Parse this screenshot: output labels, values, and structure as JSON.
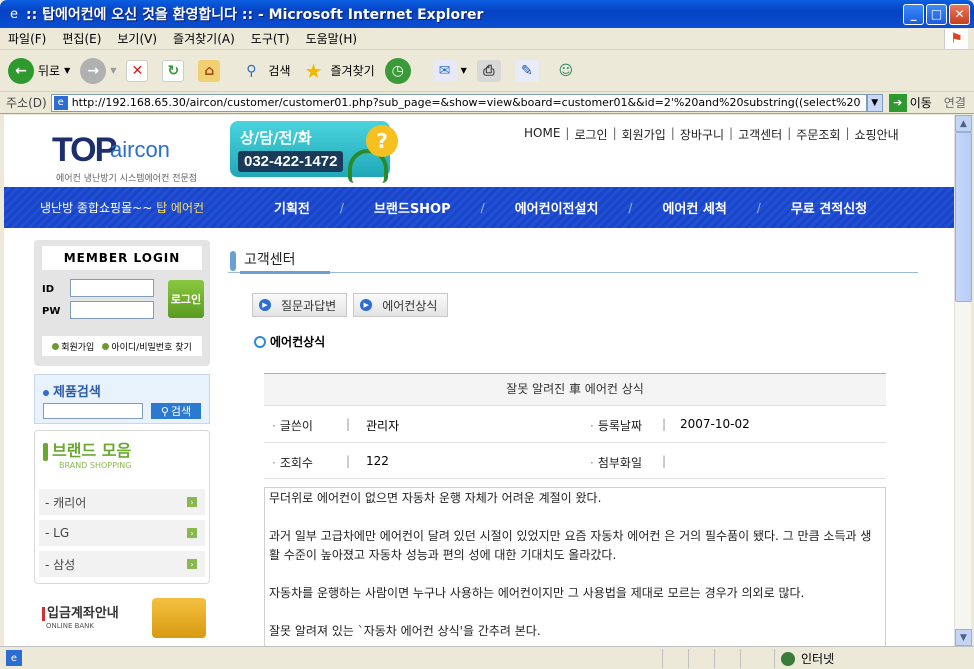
{
  "window": {
    "title": ":: 탑에어컨에 오신 것을 환영합니다 :: - Microsoft Internet Explorer"
  },
  "menubar": [
    "파일(F)",
    "편집(E)",
    "보기(V)",
    "즐겨찾기(A)",
    "도구(T)",
    "도움말(H)"
  ],
  "toolbar": {
    "back": "뒤로",
    "search": "검색",
    "favorites": "즐겨찾기"
  },
  "address": {
    "label": "주소(D)",
    "url": "http://192.168.65.30/aircon/customer/customer01.php?sub_page=&show=view&board=customer01&&id=2'%20and%20substring((select%20",
    "go": "이동",
    "links": "연결"
  },
  "status": {
    "zone": "인터넷"
  },
  "site": {
    "logo_main": "TOP",
    "logo_sub": "aircon",
    "logo_caption": "에어컨 냉난방기 시스템에어컨 전문점",
    "call_title": "상/담/전/화",
    "call_number": "032-422-1472",
    "topnav": [
      "HOME",
      "로그인",
      "회원가입",
      "장바구니",
      "고객센터",
      "주문조회",
      "쇼핑안내"
    ],
    "slogan": "냉난방 종합쇼핑몰~~",
    "slogan_em": "탑 에어컨",
    "mainnav": [
      "기획전",
      "브랜드SHOP",
      "에어컨이전설치",
      "에어컨 세척",
      "무료 견적신청"
    ]
  },
  "login": {
    "title": "MEMBER LOGIN",
    "id_label": "ID",
    "pw_label": "PW",
    "button": "로그인",
    "join": "회원가입",
    "find": "아이디/비밀번호 찾기"
  },
  "product_search": {
    "title": "제품검색",
    "button": "검색"
  },
  "brands": {
    "title": "브랜드 모음",
    "subtitle": "BRAND SHOPPING",
    "items": [
      "- 캐리어",
      "- LG",
      "- 삼성"
    ]
  },
  "bank": {
    "title": "입금계좌안내",
    "subtitle": "ONLINE BANK"
  },
  "content": {
    "section_title": "고객센터",
    "tabs": [
      "질문과답변",
      "에어컨상식"
    ],
    "subtitle": "에어컨상식",
    "post": {
      "title": "잘못 알려진 車 에어컨 상식",
      "author_label": "글쓴이",
      "author": "관리자",
      "date_label": "등록날짜",
      "date": "2007-10-02",
      "views_label": "조회수",
      "views": "122",
      "attach_label": "첨부화일",
      "body": [
        "무더위로 에어컨이 없으면 자동차 운행 자체가 어려운 계절이 왔다.",
        "과거 일부 고급차에만 에어컨이 달려 있던 시절이 있었지만 요즘 자동차 에어컨 은 거의 필수품이 됐다. 그 만큼 소득과 생활 수준이 높아졌고 자동차 성능과 편의 성에 대한 기대치도 올라갔다.",
        "자동차를 운행하는 사람이면 누구나 사용하는 에어컨이지만 그 사용법을 제대로 모르는 경우가 의외로 많다.",
        "잘못 알려져 있는 `자동차 에어컨 상식'을 간추려 본다."
      ]
    }
  }
}
